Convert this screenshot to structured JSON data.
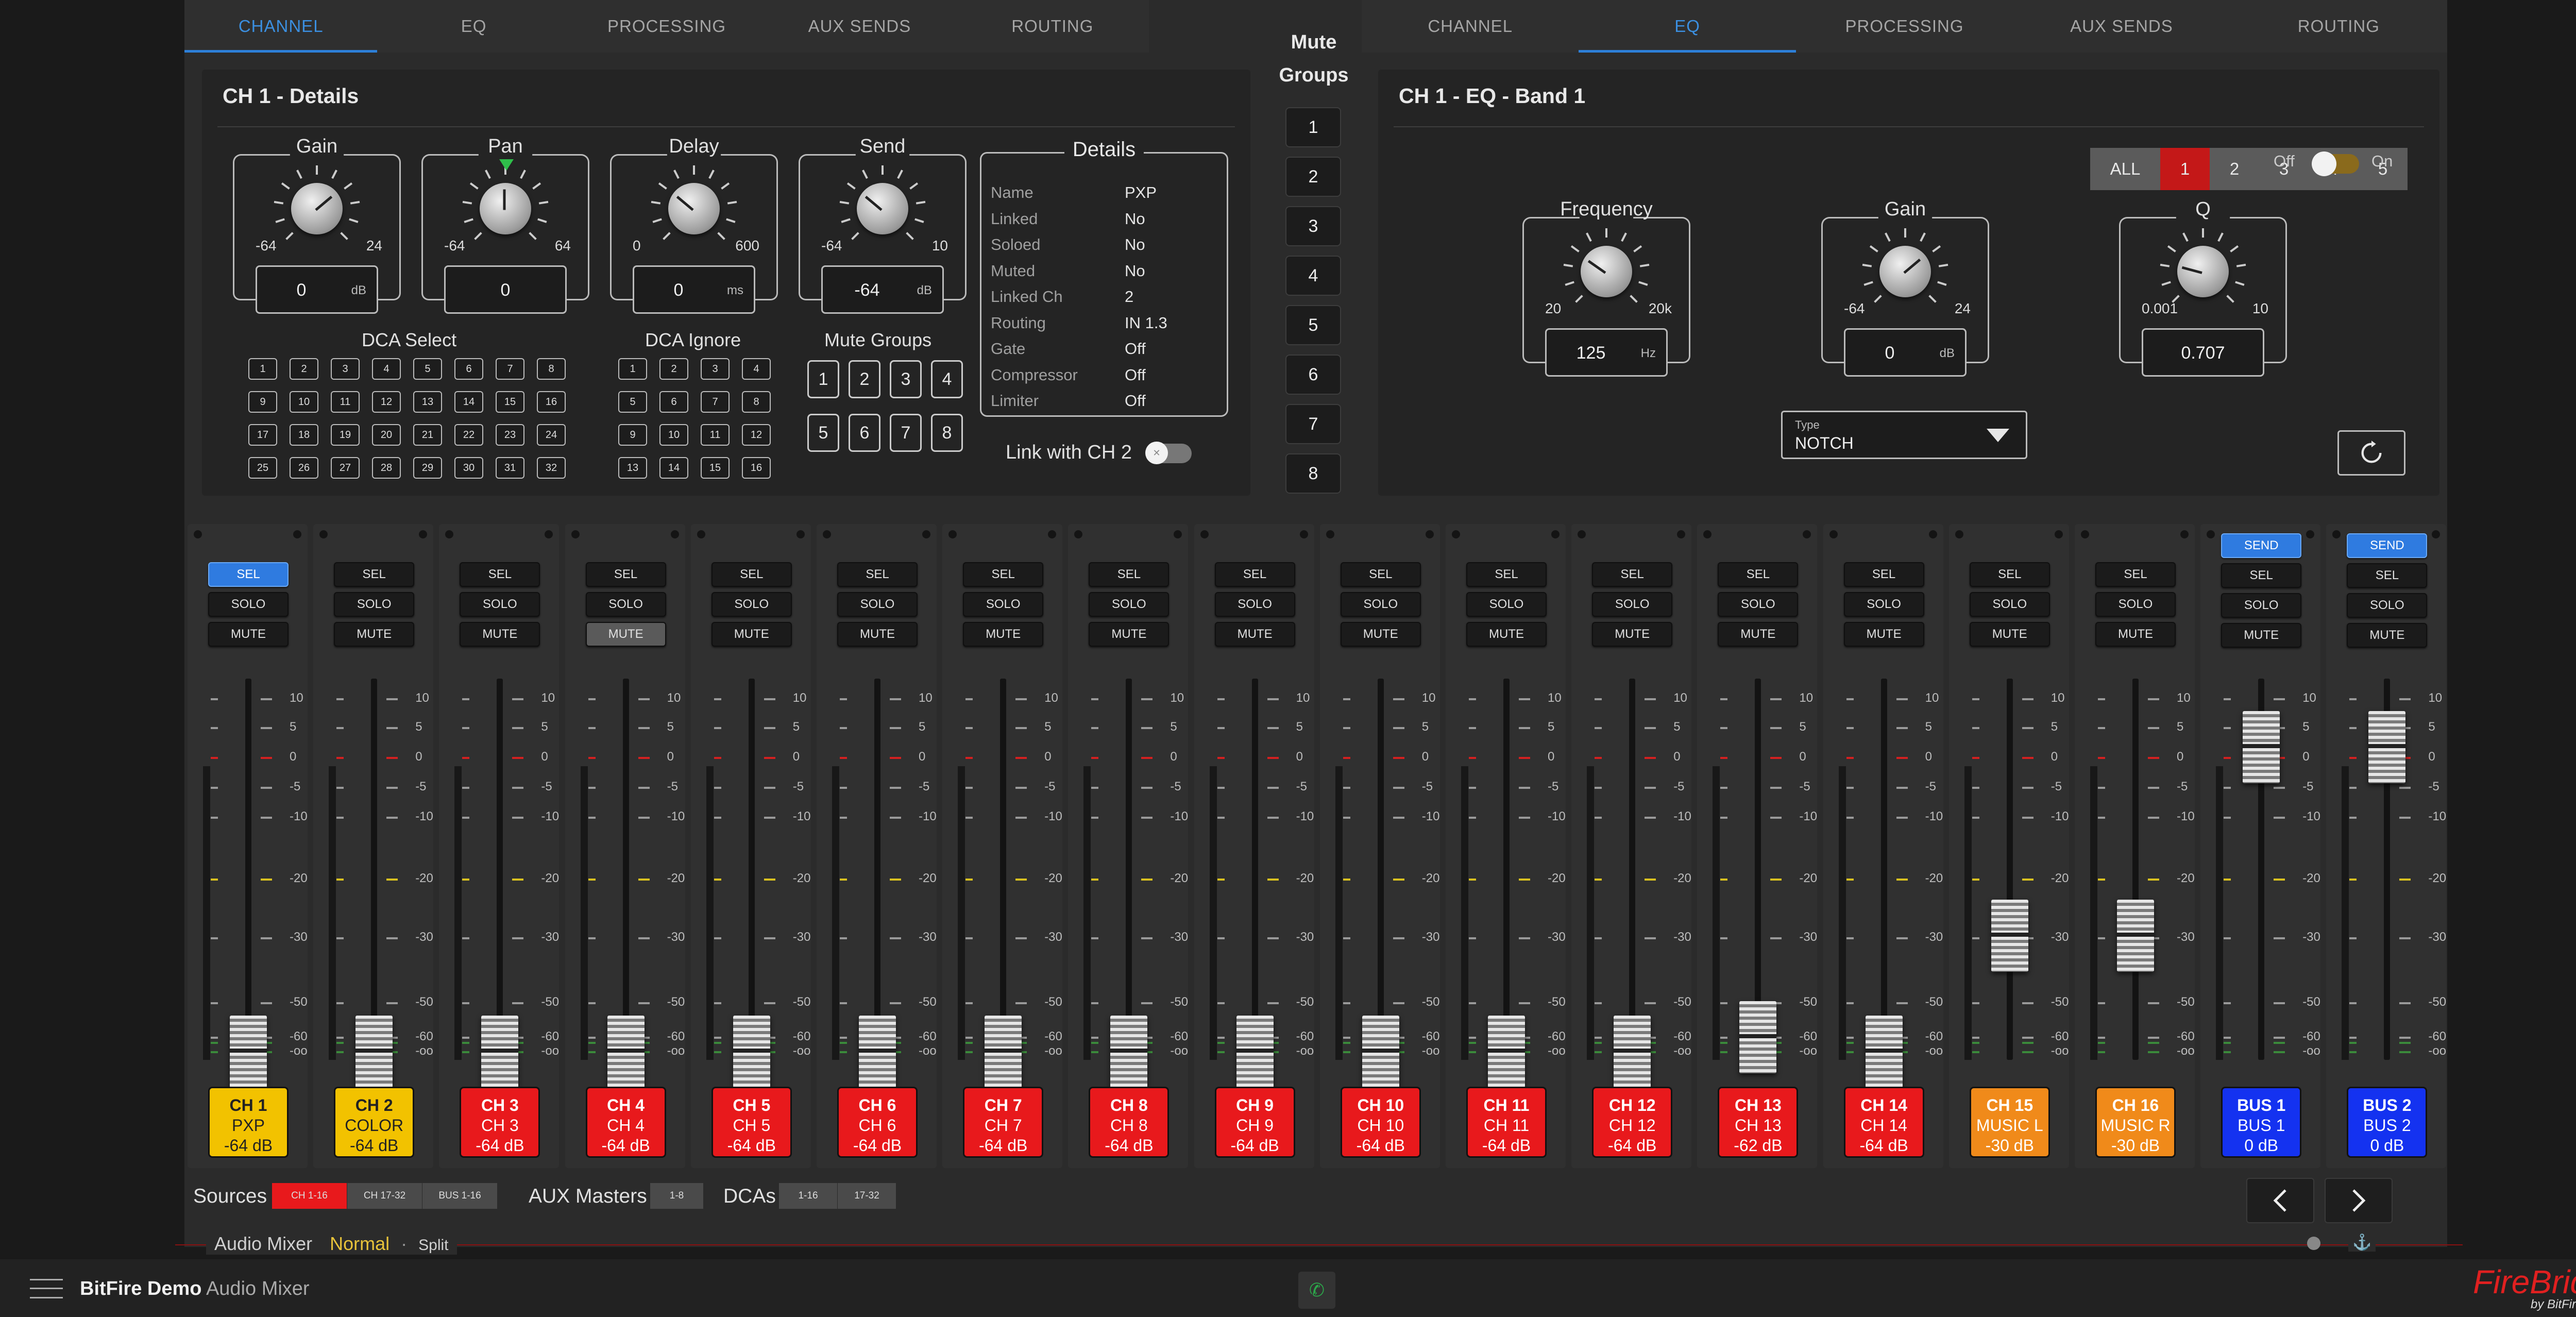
{
  "tabs_left": [
    "CHANNEL",
    "EQ",
    "PROCESSING",
    "AUX SENDS",
    "ROUTING"
  ],
  "tabs_right": [
    "CHANNEL",
    "EQ",
    "PROCESSING",
    "AUX SENDS",
    "ROUTING"
  ],
  "mute_groups_title_1": "Mute",
  "mute_groups_title_2": "Groups",
  "mute_groups": [
    "1",
    "2",
    "3",
    "4",
    "5",
    "6",
    "7",
    "8"
  ],
  "details_panel": {
    "title": "CH 1 - Details",
    "gain": {
      "label": "Gain",
      "min": "-64",
      "max": "24",
      "value": "0",
      "unit": "dB"
    },
    "pan": {
      "label": "Pan",
      "min": "-64",
      "max": "64",
      "value": "0",
      "unit": ""
    },
    "delay": {
      "label": "Delay",
      "min": "0",
      "max": "600",
      "value": "0",
      "unit": "ms"
    },
    "send": {
      "label": "Send",
      "min": "-64",
      "max": "10",
      "value": "-64",
      "unit": "dB"
    },
    "dca_select_label": "DCA Select",
    "dca_ignore_label": "DCA Ignore",
    "mute_groups_label": "Mute Groups",
    "dca_select": [
      "1",
      "2",
      "3",
      "4",
      "5",
      "6",
      "7",
      "8",
      "9",
      "10",
      "11",
      "12",
      "13",
      "14",
      "15",
      "16",
      "17",
      "18",
      "19",
      "20",
      "21",
      "22",
      "23",
      "24",
      "25",
      "26",
      "27",
      "28",
      "29",
      "30",
      "31",
      "32"
    ],
    "dca_ignore": [
      "1",
      "2",
      "3",
      "4",
      "5",
      "6",
      "7",
      "8",
      "9",
      "10",
      "11",
      "12",
      "13",
      "14",
      "15",
      "16"
    ],
    "mute_group_btns": [
      "1",
      "2",
      "3",
      "4",
      "5",
      "6",
      "7",
      "8"
    ],
    "details_title": "Details",
    "details": [
      {
        "k": "Name",
        "v": "PXP"
      },
      {
        "k": "Linked",
        "v": "No"
      },
      {
        "k": "Soloed",
        "v": "No"
      },
      {
        "k": "Muted",
        "v": "No"
      },
      {
        "k": "Linked Ch",
        "v": "2"
      },
      {
        "k": "Routing",
        "v": "IN 1.3"
      },
      {
        "k": "Gate",
        "v": "Off"
      },
      {
        "k": "Compressor",
        "v": "Off"
      },
      {
        "k": "Limiter",
        "v": "Off"
      }
    ],
    "link_label": "Link with CH 2"
  },
  "eq_panel": {
    "title": "CH 1 - EQ - Band 1",
    "bands": [
      "ALL",
      "1",
      "2",
      "3",
      "4",
      "5"
    ],
    "active_band": "1",
    "off_label": "Off",
    "on_label": "On",
    "frequency": {
      "label": "Frequency",
      "min": "20",
      "max": "20k",
      "value": "125",
      "unit": "Hz"
    },
    "gain": {
      "label": "Gain",
      "min": "-64",
      "max": "24",
      "value": "0",
      "unit": "dB"
    },
    "q": {
      "label": "Q",
      "min": "0.001",
      "max": "10",
      "value": "0.707",
      "unit": ""
    },
    "type_caption": "Type",
    "type_value": "NOTCH"
  },
  "scale": [
    "10",
    "5",
    "0",
    "-5",
    "-10",
    "-20",
    "-30",
    "-50",
    "-60",
    "-oo"
  ],
  "btn_send": "SEND",
  "btn_sel": "SEL",
  "btn_solo": "SOLO",
  "btn_mute": "MUTE",
  "strips": [
    {
      "ch": "CH 1",
      "name": "PXP",
      "db": "-64 dB",
      "color": "#f2c200",
      "text": "#222",
      "level": 0.0,
      "sel": true,
      "send": false,
      "mutelit": false
    },
    {
      "ch": "CH 2",
      "name": "COLOR",
      "db": "-64 dB",
      "color": "#f2c200",
      "text": "#222",
      "level": 0.0,
      "sel": false,
      "send": false,
      "mutelit": false
    },
    {
      "ch": "CH 3",
      "name": "CH 3",
      "db": "-64 dB",
      "color": "#e8191c",
      "text": "#fff",
      "level": 0.0,
      "sel": false,
      "send": false,
      "mutelit": false
    },
    {
      "ch": "CH 4",
      "name": "CH 4",
      "db": "-64 dB",
      "color": "#e8191c",
      "text": "#fff",
      "level": 0.0,
      "sel": false,
      "send": false,
      "mutelit": true
    },
    {
      "ch": "CH 5",
      "name": "CH 5",
      "db": "-64 dB",
      "color": "#e8191c",
      "text": "#fff",
      "level": 0.0,
      "sel": false,
      "send": false,
      "mutelit": false
    },
    {
      "ch": "CH 6",
      "name": "CH 6",
      "db": "-64 dB",
      "color": "#e8191c",
      "text": "#fff",
      "level": 0.0,
      "sel": false,
      "send": false,
      "mutelit": false
    },
    {
      "ch": "CH 7",
      "name": "CH 7",
      "db": "-64 dB",
      "color": "#e8191c",
      "text": "#fff",
      "level": 0.0,
      "sel": false,
      "send": false,
      "mutelit": false
    },
    {
      "ch": "CH 8",
      "name": "CH 8",
      "db": "-64 dB",
      "color": "#e8191c",
      "text": "#fff",
      "level": 0.0,
      "sel": false,
      "send": false,
      "mutelit": false
    },
    {
      "ch": "CH 9",
      "name": "CH 9",
      "db": "-64 dB",
      "color": "#e8191c",
      "text": "#fff",
      "level": 0.0,
      "sel": false,
      "send": false,
      "mutelit": false
    },
    {
      "ch": "CH 10",
      "name": "CH 10",
      "db": "-64 dB",
      "color": "#e8191c",
      "text": "#fff",
      "level": 0.0,
      "sel": false,
      "send": false,
      "mutelit": false
    },
    {
      "ch": "CH 11",
      "name": "CH 11",
      "db": "-64 dB",
      "color": "#e8191c",
      "text": "#fff",
      "level": 0.0,
      "sel": false,
      "send": false,
      "mutelit": false
    },
    {
      "ch": "CH 12",
      "name": "CH 12",
      "db": "-64 dB",
      "color": "#e8191c",
      "text": "#fff",
      "level": 0.0,
      "sel": false,
      "send": false,
      "mutelit": false
    },
    {
      "ch": "CH 13",
      "name": "CH 13",
      "db": "-62 dB",
      "color": "#e8191c",
      "text": "#fff",
      "level": 0.04,
      "sel": false,
      "send": false,
      "mutelit": false
    },
    {
      "ch": "CH 14",
      "name": "CH 14",
      "db": "-64 dB",
      "color": "#e8191c",
      "text": "#fff",
      "level": 0.0,
      "sel": false,
      "send": false,
      "mutelit": false
    },
    {
      "ch": "CH 15",
      "name": "MUSIC L",
      "db": "-30 dB",
      "color": "#f08a1a",
      "text": "#fff",
      "level": 0.32,
      "sel": false,
      "send": false,
      "mutelit": false
    },
    {
      "ch": "CH 16",
      "name": "MUSIC R",
      "db": "-30 dB",
      "color": "#f08a1a",
      "text": "#fff",
      "level": 0.32,
      "sel": false,
      "send": false,
      "mutelit": false
    },
    {
      "ch": "BUS 1",
      "name": "BUS 1",
      "db": "0 dB",
      "color": "#1432f0",
      "text": "#fff",
      "level": 0.84,
      "sel": false,
      "send": true,
      "mutelit": false
    },
    {
      "ch": "BUS 2",
      "name": "BUS 2",
      "db": "0 dB",
      "color": "#1432f0",
      "text": "#fff",
      "level": 0.84,
      "sel": false,
      "send": true,
      "mutelit": false
    }
  ],
  "bottom": {
    "sources_label": "Sources",
    "sources": [
      "CH 1-16",
      "CH 17-32",
      "BUS 1-16"
    ],
    "aux_label": "AUX Masters",
    "aux": [
      "1-8"
    ],
    "dcas_label": "DCAs",
    "dcas": [
      "1-16",
      "17-32"
    ]
  },
  "view_bar": {
    "audio_mixer": "Audio Mixer",
    "normal": "Normal",
    "sep": "·",
    "split": "Split"
  },
  "footer": {
    "app": "BitFire Demo",
    "sub": "Audio Mixer",
    "brand": "FireBridge",
    "brand_sub": "by BitFire"
  }
}
